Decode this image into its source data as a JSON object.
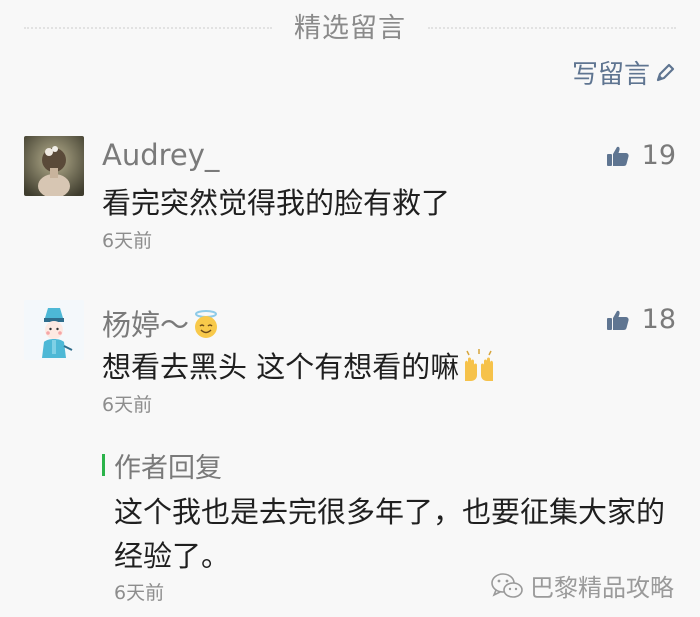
{
  "header": {
    "title": "精选留言"
  },
  "write_comment": {
    "label": "写留言",
    "icon": "pencil-icon"
  },
  "comments": [
    {
      "nickname": "Audrey_",
      "content": "看完突然觉得我的脸有救了",
      "time": "6天前",
      "likes": "19",
      "like_icon": "thumbs-up-icon"
    },
    {
      "nickname": "杨婷～",
      "nickname_emoji": "angel-emoji",
      "content": "想看去黑头 这个有想看的嘛",
      "content_emoji": "raised-hands-emoji",
      "time": "6天前",
      "likes": "18",
      "like_icon": "thumbs-up-icon"
    }
  ],
  "author_reply": {
    "title": "作者回复",
    "text": "这个我也是去完很多年了，也要征集大家的经验了。",
    "time": "6天前",
    "accent_color": "#2bb34a"
  },
  "watermark": {
    "text": "巴黎精品攻略",
    "icon": "wechat-icon"
  },
  "colors": {
    "link": "#5f7591",
    "like_icon": "#5f7591",
    "muted_text": "#8d8d8d"
  }
}
